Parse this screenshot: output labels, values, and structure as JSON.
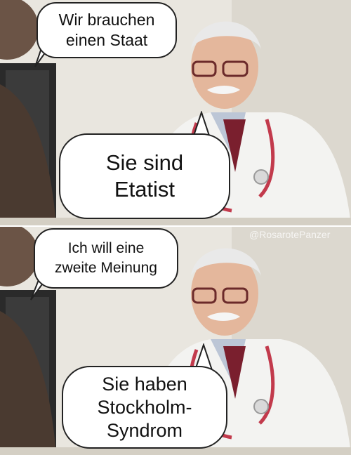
{
  "panels": [
    {
      "patient_bubble": [
        "Wir brauchen",
        "einen Staat"
      ],
      "doctor_bubble": [
        "Sie sind",
        "Etatist"
      ]
    },
    {
      "patient_bubble": [
        "Ich will eine",
        "zweite Meinung"
      ],
      "doctor_bubble": [
        "Sie haben",
        "Stockholm-",
        "Syndrom"
      ]
    }
  ],
  "watermark": "@RosarotePanzer",
  "colors": {
    "background": "#e9e6df",
    "coat": "#f3f3f1",
    "stethoscope": "#c23a4c",
    "tie": "#7a1f2e",
    "monitor": "#2a2a2a",
    "patient_jacket": "#4a3a30"
  }
}
